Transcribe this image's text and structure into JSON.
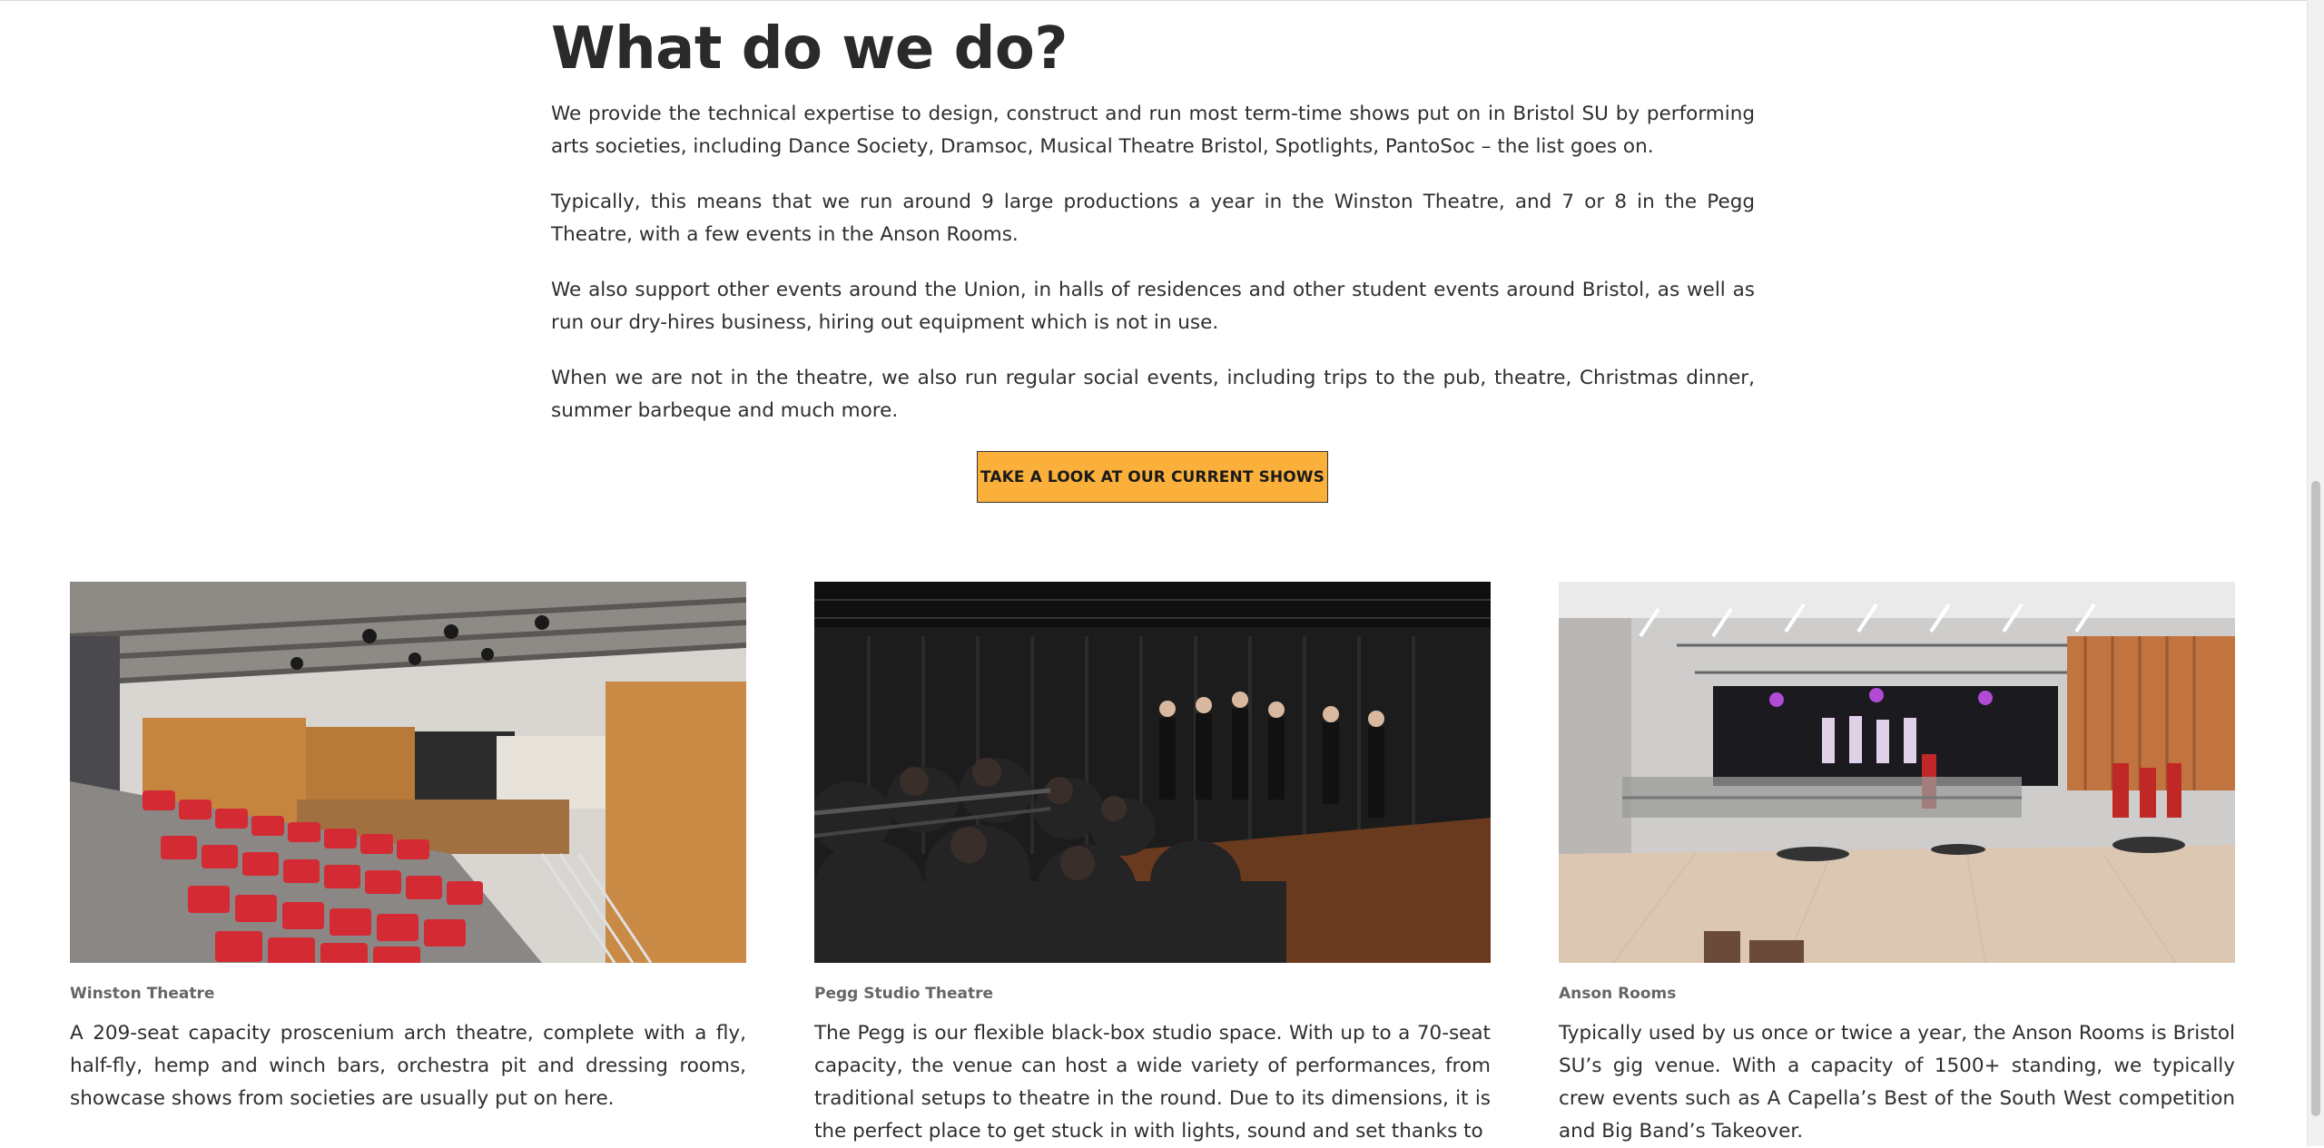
{
  "section": {
    "heading": "What do we do?",
    "paragraphs": [
      "We provide the technical expertise to design, construct and run most term-time shows put on in Bristol SU by performing arts societies, including Dance Society, Dramsoc, Musical Theatre Bristol, Spotlights, PantoSoc – the list goes on.",
      "Typically, this means that we run around 9 large productions a year in the Winston Theatre, and 7 or 8 in the Pegg Theatre, with a few events in the Anson Rooms.",
      "We also support other events around the Union, in halls of residences and other student events around Bristol, as well as run our dry-hires business, hiring out equipment which is not in use.",
      "When we are not in the theatre, we also run regular social events, including trips to the pub, theatre, Christmas dinner, summer barbeque and much more."
    ],
    "cta_label": "TAKE A LOOK AT OUR CURRENT SHOWS"
  },
  "venues": [
    {
      "caption": "Winston Theatre",
      "description": "A 209-seat capacity proscenium arch theatre, complete with a fly, half-fly, hemp and winch bars, orchestra pit and dressing rooms, showcase shows from societies are usually put on here."
    },
    {
      "caption": "Pegg Studio Theatre",
      "description": "The Pegg is our flexible black-box studio space. With up to a 70-seat capacity, the venue can host a wide variety of performances, from traditional setups to theatre in the round. Due to its dimensions, it is the perfect place to get stuck in with lights, sound and set thanks to"
    },
    {
      "caption": "Anson Rooms",
      "description": "Typically used by us once or twice a year, the Anson Rooms is Bristol SU’s gig venue. With a capacity of 1500+ standing, we typically crew events such as A Capella’s Best of the South West competition and Big Band’s Takeover."
    }
  ],
  "colors": {
    "cta_background": "#fbb03b",
    "seat_red": "#d42a34",
    "wood": "#c98a45"
  }
}
